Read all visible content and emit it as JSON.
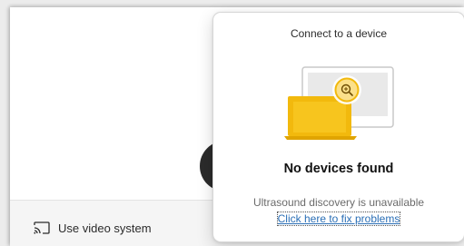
{
  "background_app": {
    "bottom_bar": {
      "video_system_label": "Use video system",
      "video_system_icon": "cast-icon"
    }
  },
  "flyout": {
    "title": "Connect to a device",
    "illustration": "laptop-and-monitor-search-illustration",
    "status_heading": "No devices found",
    "discovery_note": "Ultrasound discovery is unavailable",
    "fix_link_label": "Click here to fix problems"
  },
  "colors": {
    "laptop_accent": "#f2b90d",
    "link": "#2b6fb6",
    "search_badge": "#f2b90d"
  }
}
